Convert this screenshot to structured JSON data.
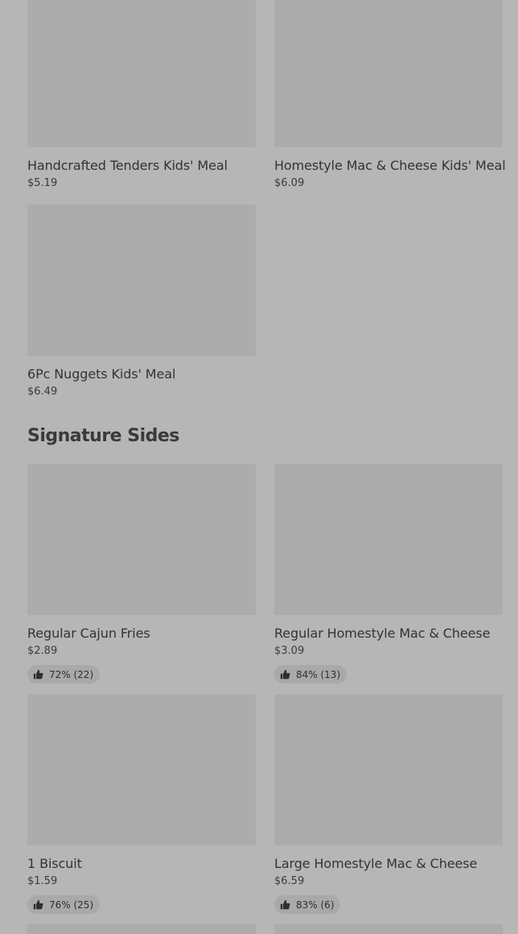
{
  "kids_meals": {
    "items": [
      {
        "name": "Handcrafted Tenders Kids' Meal",
        "price": "$5.19"
      },
      {
        "name": "Homestyle Mac & Cheese Kids' Meal",
        "price": "$6.09"
      },
      {
        "name": "6Pc Nuggets Kids' Meal",
        "price": "$6.49"
      }
    ]
  },
  "signature_sides": {
    "title": "Signature Sides",
    "items": [
      {
        "name": "Regular Cajun Fries",
        "price": "$2.89",
        "rating": "72% (22)"
      },
      {
        "name": "Regular Homestyle Mac & Cheese",
        "price": "$3.09",
        "rating": "84% (13)"
      },
      {
        "name": "1 Biscuit",
        "price": "$1.59",
        "rating": "76% (25)"
      },
      {
        "name": "Large Homestyle Mac & Cheese",
        "price": "$6.59",
        "rating": "83% (6)"
      }
    ]
  },
  "icons": {
    "rating": "thumbs-up-icon"
  }
}
